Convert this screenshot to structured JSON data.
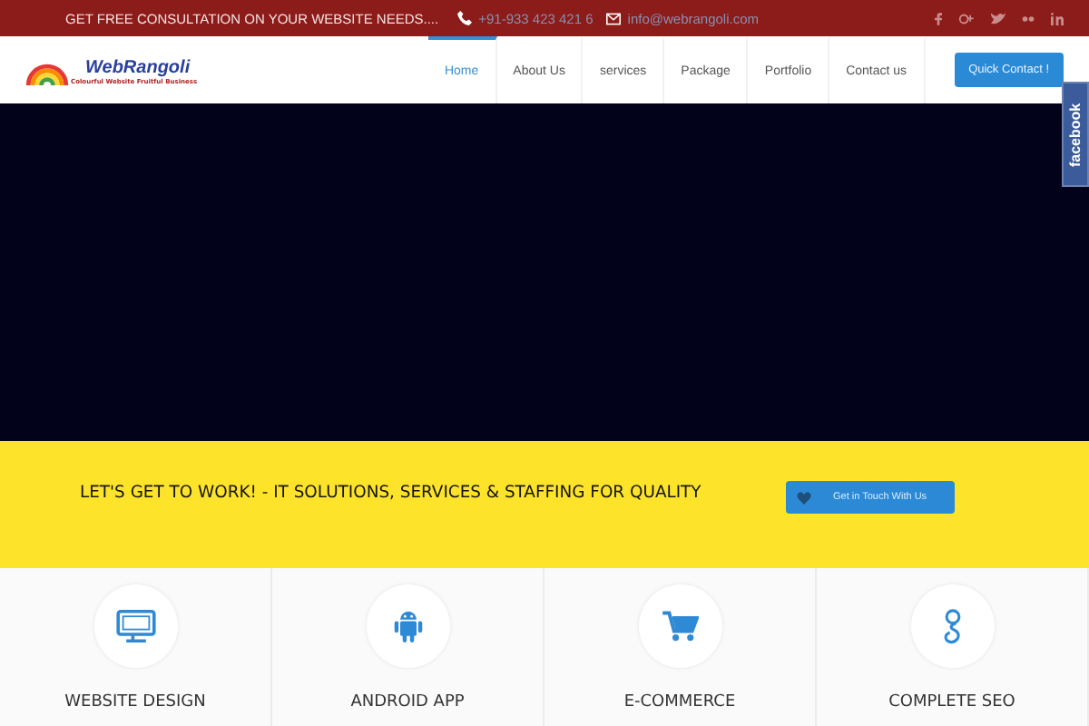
{
  "top_bar": {
    "message": "GET FREE CONSULTATION ON YOUR WEBSITE NEEDS....",
    "phone": "+91-933 423 421 6",
    "email": "info@webrangoli.com"
  },
  "logo": {
    "name": "WebRangoli",
    "tagline": "Colourful Website Fruitful Business"
  },
  "nav": [
    {
      "label": "Home",
      "selected": true
    },
    {
      "label": "About Us",
      "selected": false
    },
    {
      "label": "services",
      "selected": false
    },
    {
      "label": "Package",
      "selected": false
    },
    {
      "label": "Portfolio",
      "selected": false
    },
    {
      "label": "Contact us",
      "selected": false
    }
  ],
  "quick_contact": "Quick Contact !",
  "facebook_tab": "facebook",
  "banner": {
    "heading": "LET'S GET TO WORK! - IT SOLUTIONS, SERVICES & STAFFING FOR QUALITY",
    "button": "Get in Touch With Us"
  },
  "services": [
    {
      "kind": "monitor",
      "title": "WEBSITE DESIGN"
    },
    {
      "kind": "android",
      "title": "ANDROID APP"
    },
    {
      "kind": "cart",
      "title": "E-COMMERCE"
    },
    {
      "kind": "google",
      "title": "COMPLETE SEO"
    }
  ]
}
